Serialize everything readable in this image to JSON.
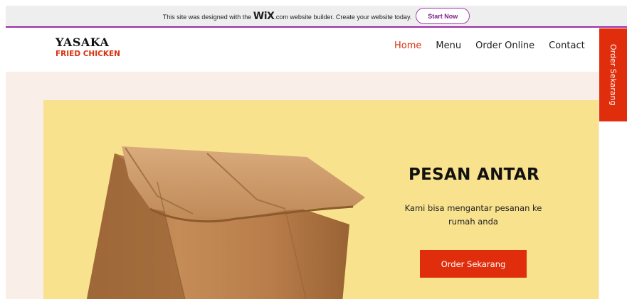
{
  "wix_banner": {
    "text_before": "This site was designed with the ",
    "logo": "WiX",
    "text_after": ".com website builder. Create your website today.",
    "button": "Start Now"
  },
  "header": {
    "logo_line1": "YASAKA",
    "logo_line2": "FRIED CHICKEN",
    "nav": [
      "Home",
      "Menu",
      "Order Online",
      "Contact"
    ],
    "active_nav": "Home"
  },
  "side_tab": {
    "label": "Order Sekarang"
  },
  "hero": {
    "title": "PESAN ANTAR",
    "description": "Kami bisa mengantar pesanan ke rumah anda",
    "button": "Order Sekarang",
    "image": "paper-bag"
  },
  "colors": {
    "accent": "#e02e0c",
    "hero_bg": "#f8e28d",
    "page_bg": "#f9eee8",
    "wix_purple": "#9b2ba6"
  }
}
